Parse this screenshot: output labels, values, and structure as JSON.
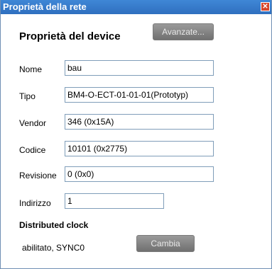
{
  "window": {
    "title": "Proprietà della rete",
    "close_symbol": "✕"
  },
  "device": {
    "section_title": "Proprietà del device",
    "advanced_button": "Avanzate...",
    "fields": {
      "nome": {
        "label": "Nome",
        "value": "bau"
      },
      "tipo": {
        "label": "Tipo",
        "value": "BM4-O-ECT-01-01-01(Prototyp)"
      },
      "vendor": {
        "label": "Vendor",
        "value": "346 (0x15A)"
      },
      "codice": {
        "label": "Codice",
        "value": "10101 (0x2775)"
      },
      "revisione": {
        "label": "Revisione",
        "value": "0 (0x0)"
      },
      "indirizzo": {
        "label": "Indirizzo",
        "value": "1"
      }
    }
  },
  "distributed_clock": {
    "title": "Distributed clock",
    "status": "abilitato, SYNC0",
    "change_button": "Cambia"
  }
}
